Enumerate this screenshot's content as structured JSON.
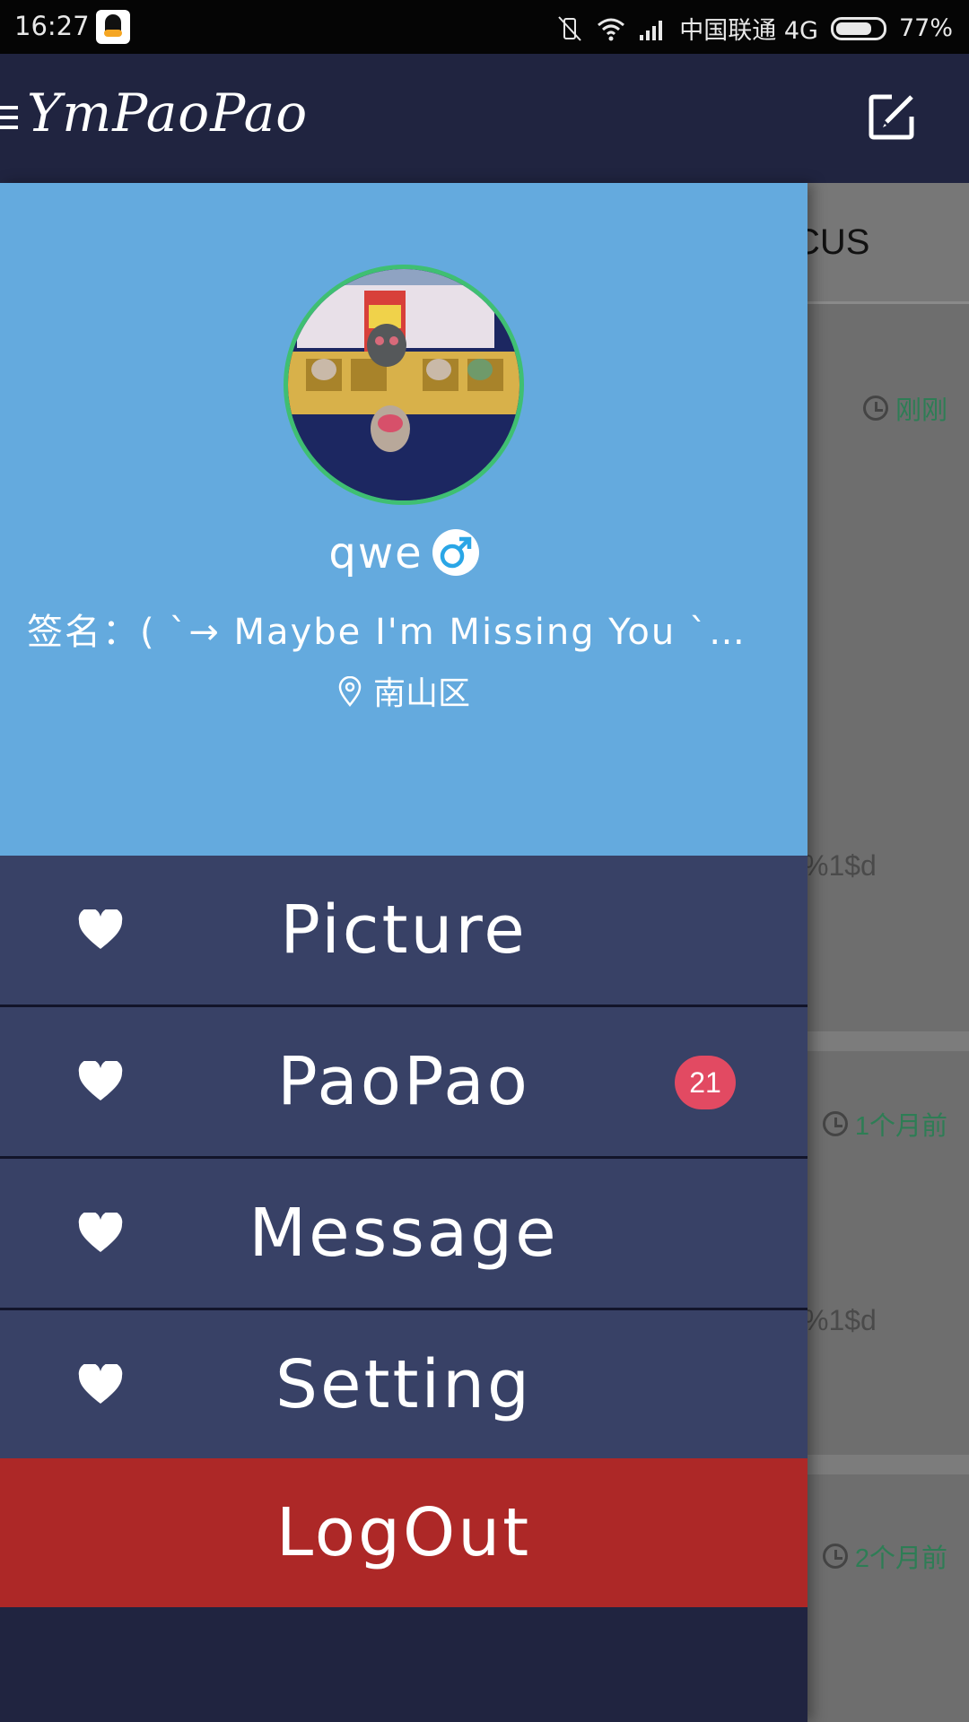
{
  "status_bar": {
    "time": "16:27",
    "carrier": "中国联通 4G",
    "battery": "77%",
    "battery_level": 0.77,
    "icons": [
      "qq-icon",
      "vibrate-off-icon",
      "wifi-icon",
      "signal-icon",
      "battery-icon"
    ]
  },
  "toolbar": {
    "title": "YmPaoPao",
    "menu_icon": "menu-icon",
    "edit_icon": "edit-icon"
  },
  "background": {
    "tab_fragment": "CUS",
    "cards": [
      {
        "time": "刚刚",
        "format_text": "%1$d"
      },
      {
        "time": "1个月前",
        "format_text": "%1$d"
      },
      {
        "time": "2个月前"
      }
    ]
  },
  "profile": {
    "username": "qwe",
    "gender_icon": "male-icon",
    "signature": "签名：( ˋ→ Maybe I'm Missing You ˋ…",
    "location": "南山区",
    "location_icon": "pin-icon",
    "colors": {
      "header_bg": "#64aade",
      "avatar_ring": "#3fbf72"
    }
  },
  "menu": {
    "items": [
      {
        "label": "Picture",
        "icon": "heart-icon"
      },
      {
        "label": "PaoPao",
        "icon": "heart-icon",
        "badge": "21"
      },
      {
        "label": "Message",
        "icon": "heart-icon"
      },
      {
        "label": "Setting",
        "icon": "heart-icon"
      }
    ],
    "logout": "LogOut",
    "colors": {
      "item_bg": "#384166",
      "logout_bg": "#ad2827",
      "badge_bg": "#e24a62"
    }
  }
}
